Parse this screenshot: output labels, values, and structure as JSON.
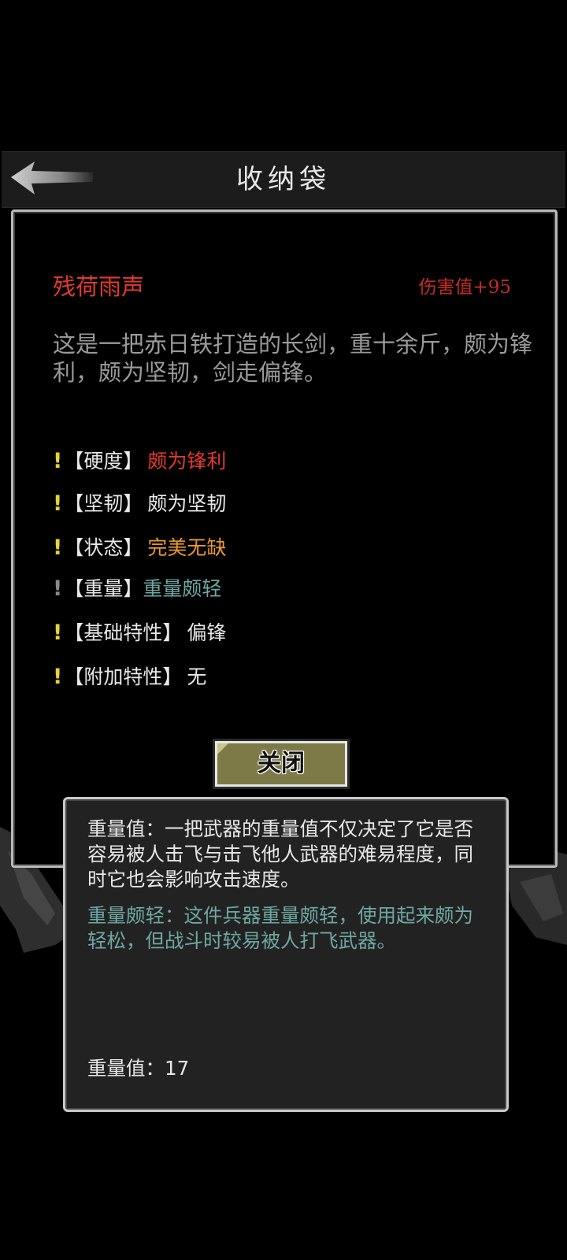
{
  "header": {
    "title": "收纳袋",
    "back_icon": "back-arrow-icon"
  },
  "item": {
    "name": "残荷雨声",
    "damage": "伤害值+95",
    "description": "这是一把赤日铁打造的长剑，重十余斤，颇为锋利，颇为坚韧，剑走偏锋。"
  },
  "attributes": [
    {
      "mark": "!",
      "label": "【硬度】",
      "value": "颇为锋利",
      "color": "#e23a2e"
    },
    {
      "mark": "!",
      "label": "【坚韧】",
      "value": "颇为坚韧",
      "color": "#e8e8e8"
    },
    {
      "mark": "!",
      "label": "【状态】",
      "value": "完美无缺",
      "color": "#e89a2a"
    },
    {
      "mark": "!",
      "label": "【重量】",
      "value": "重量颇轻",
      "color": "#6ea8a2"
    },
    {
      "mark": "!",
      "label": "【基础特性】",
      "value": "偏锋",
      "color": "#e8e8e8"
    },
    {
      "mark": "!",
      "label": "【附加特性】",
      "value": "无",
      "color": "#e8e8e8"
    }
  ],
  "close_button": {
    "label": "关闭"
  },
  "tooltip": {
    "main_text": "重量值：一把武器的重量值不仅决定了它是否容易被人击飞与击飞他人武器的难易程度，同时它也会影响攻击速度。",
    "sub_text": "重量颇轻：这件兵器重量颇轻，使用起来颇为轻松，但战斗时较易被人打飞武器。",
    "weight_line": "重量值：17"
  },
  "colors": {
    "background": "#000000",
    "header_bg": "#1c1c1c",
    "panel_border": "#b9b9b9",
    "item_name": "#e23a2e",
    "item_damage": "#c62c24",
    "description": "#9a9a9a",
    "exclaim": "#e5d23a",
    "close_button_bg": "#7d7a47",
    "tooltip_bg": "#222222",
    "tooltip_sub": "#6ea8a2"
  }
}
